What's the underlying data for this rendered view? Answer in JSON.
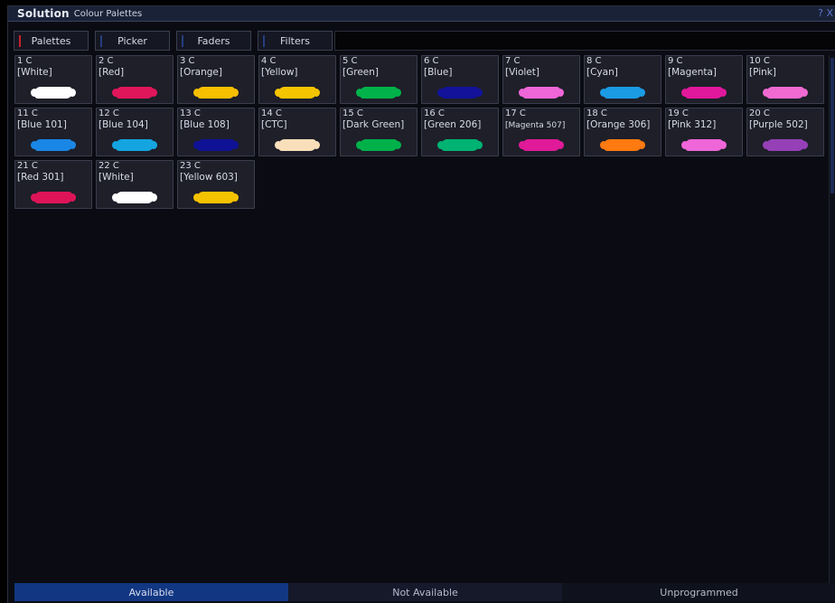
{
  "window": {
    "brand": "Solution",
    "title": "Colour Palettes",
    "controls": "? X"
  },
  "tabs": [
    {
      "label": "Palettes",
      "active": true
    },
    {
      "label": "Picker",
      "active": false
    },
    {
      "label": "Faders",
      "active": false
    },
    {
      "label": "Filters",
      "active": false
    }
  ],
  "palettes": [
    {
      "number": "1 C",
      "name": "[White]",
      "color": "#ffffff"
    },
    {
      "number": "2 C",
      "name": "[Red]",
      "color": "#e0165a"
    },
    {
      "number": "3 C",
      "name": "[Orange]",
      "color": "#f6bf00"
    },
    {
      "number": "4 C",
      "name": "[Yellow]",
      "color": "#f5c400"
    },
    {
      "number": "5 C",
      "name": "[Green]",
      "color": "#00b24a"
    },
    {
      "number": "6 C",
      "name": "[Blue]",
      "color": "#12129a"
    },
    {
      "number": "7 C",
      "name": "[Violet]",
      "color": "#ee66d8"
    },
    {
      "number": "8 C",
      "name": "[Cyan]",
      "color": "#1a9be3"
    },
    {
      "number": "9 C",
      "name": "[Magenta]",
      "color": "#e0189c"
    },
    {
      "number": "10 C",
      "name": "[Pink]",
      "color": "#f06ad2"
    },
    {
      "number": "11 C",
      "name": "[Blue 101]",
      "color": "#1a86e6"
    },
    {
      "number": "12 C",
      "name": "[Blue 104]",
      "color": "#14a5e0"
    },
    {
      "number": "13 C",
      "name": "[Blue 108]",
      "color": "#101296"
    },
    {
      "number": "14 C",
      "name": "[CTC]",
      "color": "#f9dfb9"
    },
    {
      "number": "15 C",
      "name": "[Dark Green]",
      "color": "#00b14a"
    },
    {
      "number": "16 C",
      "name": "[Green 206]",
      "color": "#00b373"
    },
    {
      "number": "17 C",
      "name": "[Magenta 507]",
      "color": "#e01a98",
      "small": true
    },
    {
      "number": "18 C",
      "name": "[Orange 306]",
      "color": "#ff7a10"
    },
    {
      "number": "19 C",
      "name": "[Pink 312]",
      "color": "#ee66d8"
    },
    {
      "number": "20 C",
      "name": "[Purple 502]",
      "color": "#9640b8"
    },
    {
      "number": "21 C",
      "name": "[Red 301]",
      "color": "#de1458"
    },
    {
      "number": "22 C",
      "name": "[White]",
      "color": "#ffffff"
    },
    {
      "number": "23 C",
      "name": "[Yellow 603]",
      "color": "#f5c200"
    }
  ],
  "status": {
    "available": "Available",
    "not_available": "Not Available",
    "unprogrammed": "Unprogrammed"
  }
}
